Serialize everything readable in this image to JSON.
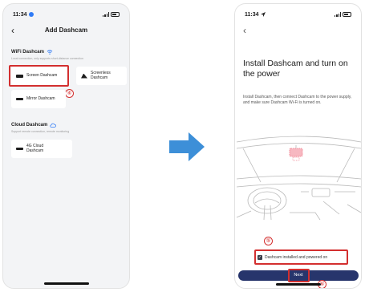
{
  "left_screen": {
    "status": {
      "time": "11:34"
    },
    "nav": {
      "title": "Add Dashcam",
      "back": "‹"
    },
    "wifi_section": {
      "title": "WiFi Dashcam",
      "subtitle": "Local connection, only supports short-distance connection",
      "cards": {
        "screen": "Screen Dashcam",
        "screenless": "Screenless Dashcam",
        "mirror": "Mirror Dashcam"
      }
    },
    "cloud_section": {
      "title": "Cloud Dashcam",
      "subtitle": "Support remote connection, remote monitoring",
      "cards": {
        "cloud_4g": "4G Cloud Dashcam"
      }
    },
    "step_marker": "④"
  },
  "right_screen": {
    "status": {
      "time": "11:34"
    },
    "nav": {
      "back": "‹"
    },
    "heading": "Install Dashcam and turn on the power",
    "description": "Install Dashcam, then connect Dashcam to the power supply, and make sure Dashcam Wi-Fi is turned on.",
    "checkbox": {
      "label": "Dashcam installed and powered on",
      "checked": true,
      "mark": "✓"
    },
    "next_button": "Next",
    "step_markers": {
      "checkbox": "⑤",
      "next": "⑥"
    }
  },
  "colors": {
    "highlight": "#d32f2f",
    "primary": "#27356c",
    "arrow": "#3d8fd8",
    "dashcam_accent": "#f07b8a"
  }
}
